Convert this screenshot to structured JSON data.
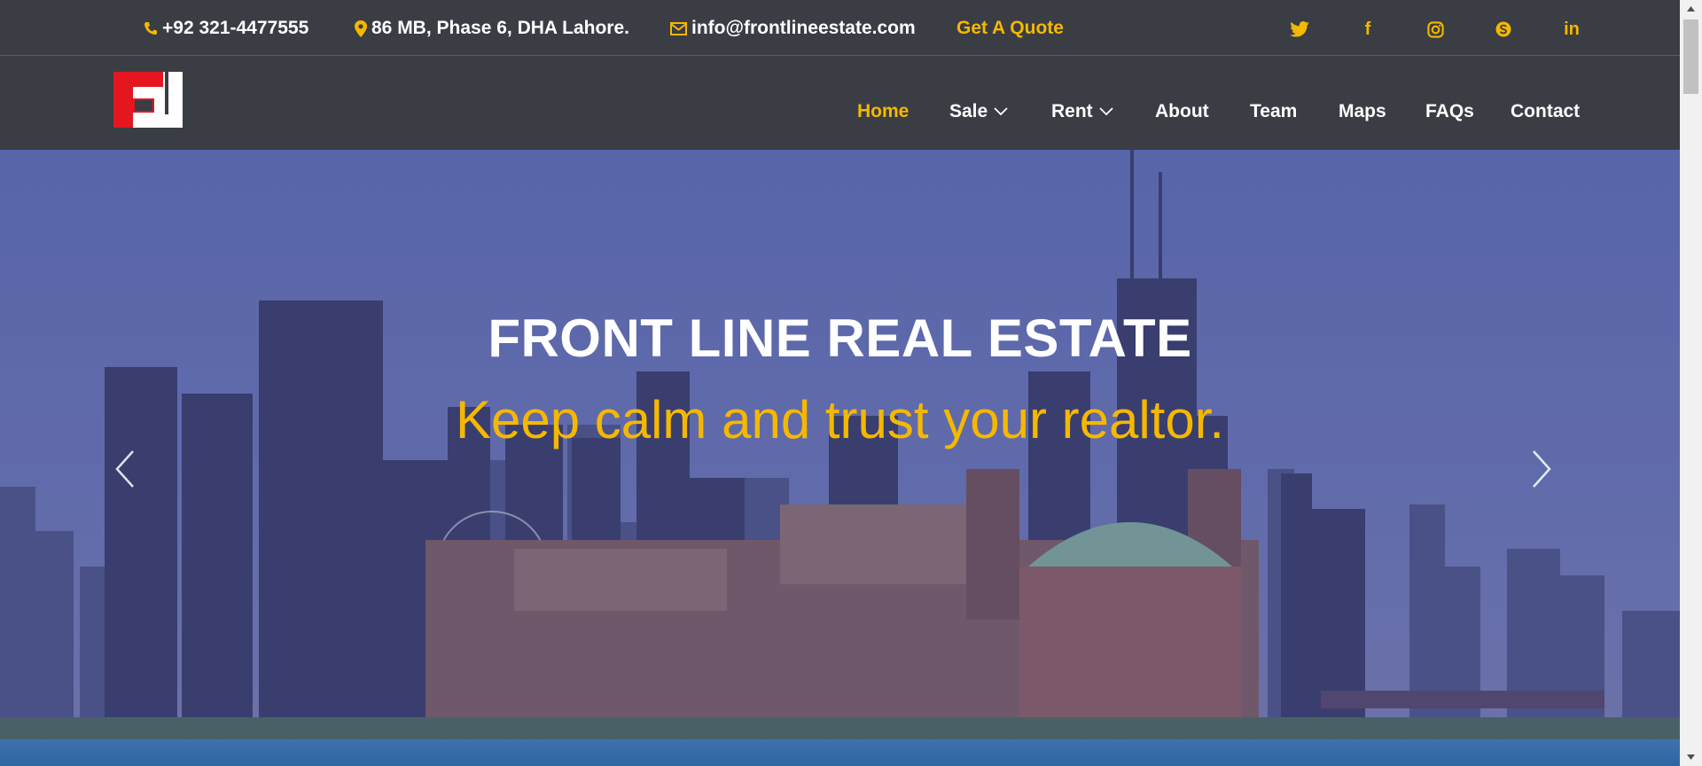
{
  "topbar": {
    "phone": "+92 321-4477555",
    "address": "86 MB, Phase 6, DHA Lahore.",
    "email": "info@frontlineestate.com",
    "quote": "Get A Quote",
    "social": [
      {
        "icon": "twitter-icon"
      },
      {
        "icon": "facebook-icon",
        "glyph": "f"
      },
      {
        "icon": "instagram-icon"
      },
      {
        "icon": "skype-icon"
      },
      {
        "icon": "linkedin-icon",
        "glyph": "in"
      }
    ]
  },
  "nav": {
    "items": [
      {
        "label": "Home",
        "active": true
      },
      {
        "label": "Sale",
        "dropdown": true
      },
      {
        "label": "Rent",
        "dropdown": true
      },
      {
        "label": "About"
      },
      {
        "label": "Team"
      },
      {
        "label": "Maps"
      },
      {
        "label": "FAQs"
      },
      {
        "label": "Contact"
      }
    ]
  },
  "hero": {
    "title": "FRONT LINE REAL ESTATE",
    "subtitle": "Keep calm and trust your realtor."
  },
  "colors": {
    "accent": "#f5b800",
    "bar": "#3a3d44",
    "logo_red": "#e4161f"
  }
}
